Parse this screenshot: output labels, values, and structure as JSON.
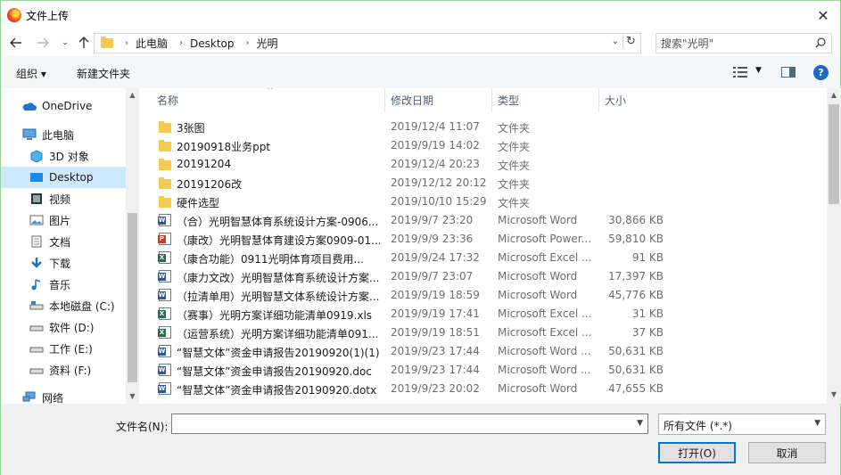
{
  "window": {
    "title": "文件上传",
    "close_glyph": "✕"
  },
  "nav": {
    "breadcrumbs": [
      "此电脑",
      "Desktop",
      "光明"
    ],
    "search_placeholder": "搜索\"光明\""
  },
  "toolbar": {
    "organize": "组织 ▾",
    "new_folder": "新建文件夹"
  },
  "sidebar": {
    "items": [
      {
        "label": "OneDrive",
        "icon": "cloud-icon"
      },
      {
        "label": "此电脑",
        "icon": "computer-icon"
      },
      {
        "label": "3D 对象",
        "icon": "3d-objects-icon"
      },
      {
        "label": "Desktop",
        "icon": "desktop-icon",
        "selected": true
      },
      {
        "label": "视频",
        "icon": "video-icon"
      },
      {
        "label": "图片",
        "icon": "pictures-icon"
      },
      {
        "label": "文档",
        "icon": "documents-icon"
      },
      {
        "label": "下载",
        "icon": "downloads-icon"
      },
      {
        "label": "音乐",
        "icon": "music-icon"
      },
      {
        "label": "本地磁盘 (C:)",
        "icon": "drive-icon"
      },
      {
        "label": "软件 (D:)",
        "icon": "drive-icon"
      },
      {
        "label": "工作 (E:)",
        "icon": "drive-icon"
      },
      {
        "label": "资料 (F:)",
        "icon": "drive-icon"
      },
      {
        "label": "网络",
        "icon": "network-icon"
      }
    ]
  },
  "columns": {
    "name": "名称",
    "date": "修改日期",
    "type": "类型",
    "size": "大小"
  },
  "files": [
    {
      "name": "3张图",
      "date": "2019/12/4 11:07",
      "type": "文件夹",
      "size": "",
      "icon": "folder"
    },
    {
      "name": "20190918业务ppt",
      "date": "2019/9/19 14:02",
      "type": "文件夹",
      "size": "",
      "icon": "folder"
    },
    {
      "name": "20191204",
      "date": "2019/12/4 20:23",
      "type": "文件夹",
      "size": "",
      "icon": "folder"
    },
    {
      "name": "20191206改",
      "date": "2019/12/12 20:12",
      "type": "文件夹",
      "size": "",
      "icon": "folder"
    },
    {
      "name": "硬件选型",
      "date": "2019/10/10 15:29",
      "type": "文件夹",
      "size": "",
      "icon": "folder"
    },
    {
      "name": "（合）光明智慧体育系统设计方案-0906...",
      "date": "2019/9/7 23:20",
      "type": "Microsoft Word",
      "size": "30,866 KB",
      "icon": "doc"
    },
    {
      "name": "（康改）光明智慧体育建设方案0909-01...",
      "date": "2019/9/9 23:36",
      "type": "Microsoft Power...",
      "size": "59,810 KB",
      "icon": "ppt"
    },
    {
      "name": "（康合功能）0911光明体育项目费用...",
      "date": "2019/9/24 17:32",
      "type": "Microsoft Excel ...",
      "size": "91 KB",
      "icon": "xls"
    },
    {
      "name": "（康力文改）光明智慧体育系统设计方案...",
      "date": "2019/9/7 23:07",
      "type": "Microsoft Word",
      "size": "17,397 KB",
      "icon": "doc"
    },
    {
      "name": "（拉清单用）光明智慧文体系统设计方案...",
      "date": "2019/9/19 18:59",
      "type": "Microsoft Word",
      "size": "45,776 KB",
      "icon": "doc"
    },
    {
      "name": "（赛事）光明方案详细功能清单0919.xls",
      "date": "2019/9/19 17:41",
      "type": "Microsoft Excel ...",
      "size": "31 KB",
      "icon": "xls"
    },
    {
      "name": "（运营系统）光明方案详细功能清单091...",
      "date": "2019/9/19 18:51",
      "type": "Microsoft Excel ...",
      "size": "37 KB",
      "icon": "xls"
    },
    {
      "name": "“智慧文体”资金申请报告20190920(1)(1)...",
      "date": "2019/9/23 17:44",
      "type": "Microsoft Word ...",
      "size": "50,631 KB",
      "icon": "doc"
    },
    {
      "name": "“智慧文体”资金申请报告20190920.doc",
      "date": "2019/9/23 17:44",
      "type": "Microsoft Word ...",
      "size": "50,631 KB",
      "icon": "doc"
    },
    {
      "name": "“智慧文体”资金申请报告20190920.dotx",
      "date": "2019/9/23 20:02",
      "type": "Microsoft Word",
      "size": "47,655 KB",
      "icon": "doc"
    }
  ],
  "bottom": {
    "filename_label": "文件名(N):",
    "filename_value": "",
    "filter": "所有文件 (*.*)",
    "open": "打开(O)",
    "cancel": "取消"
  }
}
